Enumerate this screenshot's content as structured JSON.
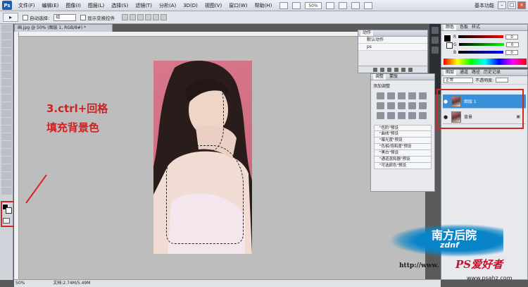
{
  "menubar": {
    "logo": "Ps",
    "items": [
      "文件(F)",
      "编辑(E)",
      "图像(I)",
      "图层(L)",
      "选择(S)",
      "滤镜(T)",
      "分析(A)",
      "3D(D)",
      "视图(V)",
      "窗口(W)",
      "帮助(H)"
    ],
    "zoom": "50%",
    "workspace": "基本功能",
    "window_controls": [
      "–",
      "□",
      "×"
    ]
  },
  "options": {
    "tool_glyph": "▸",
    "auto_select_label": "自动选择:",
    "auto_select_value": "组",
    "show_transform_label": "显示变换控件"
  },
  "document": {
    "tab_title": "画.jpg @ 50% (图层 1, RGB/8#) *"
  },
  "annotation": {
    "line1": "3.ctrl+回格",
    "line2": "填充背景色"
  },
  "actions": {
    "tabs": [
      "动作"
    ],
    "rows": [
      "默认动作",
      "ps"
    ]
  },
  "color": {
    "tabs": [
      "颜色",
      "色板",
      "样式"
    ],
    "channels": [
      {
        "label": "R",
        "value": "0"
      },
      {
        "label": "G",
        "value": "0"
      },
      {
        "label": "B",
        "value": "0"
      }
    ]
  },
  "adjustments": {
    "tabs": [
      "调整",
      "蒙版"
    ],
    "title": "添加调整",
    "presets": [
      "\"色阶\"预设",
      "\"曲线\"预设",
      "\"曝光度\"预设",
      "\"色相/饱和度\"预设",
      "\"黑白\"预设",
      "\"通道混和器\"预设",
      "\"可选颜色\"预设"
    ]
  },
  "layers": {
    "tabs": [
      "图层",
      "通道",
      "路径",
      "历史记录"
    ],
    "blend_mode": "正常",
    "opacity_label": "不透明度:",
    "items": [
      {
        "name": "图层 1",
        "selected": true
      },
      {
        "name": "背景",
        "selected": false,
        "locked": true
      }
    ]
  },
  "status": {
    "zoom": "50%",
    "doc_size": "文档:2.74M/5.49M"
  },
  "watermark": {
    "title": "南方后院",
    "subtitle": "zdnf",
    "url": "http://www.",
    "ps_brand": "PS爱好者",
    "site": "www.psahz.com"
  }
}
